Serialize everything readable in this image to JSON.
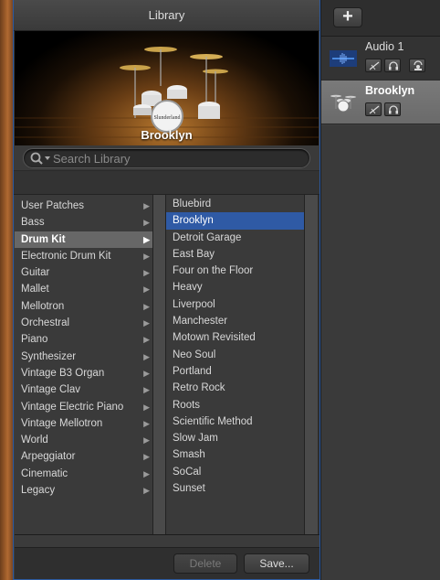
{
  "library": {
    "title": "Library",
    "preview_name": "Brooklyn",
    "search_placeholder": "Search Library",
    "categories": [
      {
        "label": "User Patches"
      },
      {
        "label": "Bass"
      },
      {
        "label": "Drum Kit",
        "selected": true
      },
      {
        "label": "Electronic Drum Kit"
      },
      {
        "label": "Guitar"
      },
      {
        "label": "Mallet"
      },
      {
        "label": "Mellotron"
      },
      {
        "label": "Orchestral"
      },
      {
        "label": "Piano"
      },
      {
        "label": "Synthesizer"
      },
      {
        "label": "Vintage B3 Organ"
      },
      {
        "label": "Vintage Clav"
      },
      {
        "label": "Vintage Electric Piano"
      },
      {
        "label": "Vintage Mellotron"
      },
      {
        "label": "World"
      },
      {
        "label": "Arpeggiator"
      },
      {
        "label": "Cinematic"
      },
      {
        "label": "Legacy"
      }
    ],
    "patches": [
      {
        "label": "Bluebird"
      },
      {
        "label": "Brooklyn",
        "selected": true
      },
      {
        "label": "Detroit Garage"
      },
      {
        "label": "East Bay"
      },
      {
        "label": "Four on the Floor"
      },
      {
        "label": "Heavy"
      },
      {
        "label": "Liverpool"
      },
      {
        "label": "Manchester"
      },
      {
        "label": "Motown Revisited"
      },
      {
        "label": "Neo Soul"
      },
      {
        "label": "Portland"
      },
      {
        "label": "Retro Rock"
      },
      {
        "label": "Roots"
      },
      {
        "label": "Scientific Method"
      },
      {
        "label": "Slow Jam"
      },
      {
        "label": "Smash"
      },
      {
        "label": "SoCal"
      },
      {
        "label": "Sunset"
      }
    ],
    "delete_label": "Delete",
    "save_label": "Save..."
  },
  "tracks": {
    "add_label": "+",
    "items": [
      {
        "name": "Audio 1",
        "icon": "waveform-icon",
        "selected": false
      },
      {
        "name": "Brooklyn",
        "icon": "drum-kit-icon",
        "selected": true
      }
    ]
  },
  "colors": {
    "selection_blue": "#2f5aa5",
    "accent_border": "#2c5aa0",
    "wood": "#9a5a28"
  }
}
